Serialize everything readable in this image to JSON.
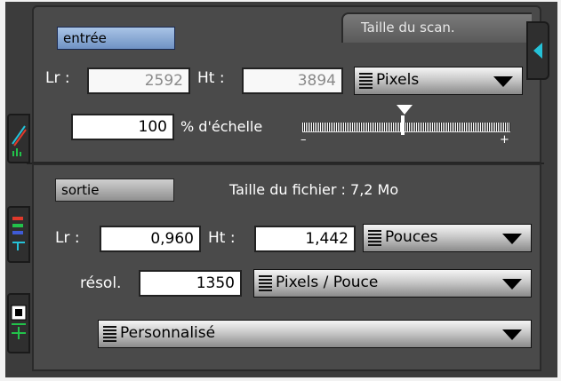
{
  "input": {
    "tag": "entrée",
    "scan_size_title": "Taille du scan.",
    "width_label": "Lr :",
    "width_value": "2592",
    "height_label": "Ht :",
    "height_value": "3894",
    "unit": "Pixels",
    "scale_value": "100",
    "scale_label": "% d'échelle",
    "slider_minus": "–",
    "slider_plus": "+"
  },
  "output": {
    "tag": "sortie",
    "file_size": "Taille du fichier : 7,2 Mo",
    "width_label": "Lr :",
    "width_value": "0,960",
    "height_label": "Ht :",
    "height_value": "1,442",
    "unit": "Pouces",
    "resolution_label": "résol.",
    "resolution_value": "1350",
    "resolution_unit": "Pixels / Pouce",
    "preset": "Personnalisé"
  },
  "icons": {
    "side_tab_1": "color-curve-icon",
    "side_tab_2": "levels-icon",
    "side_tab_3": "frame-add-icon",
    "right_tab": "collapse-arrow-icon"
  },
  "colors": {
    "panel_bg": "#4a4a4a",
    "input_tag": "#8fabd8",
    "accent_cyan": "#25c2d8",
    "accent_green": "#22c24a",
    "accent_red": "#e0392b",
    "accent_blue": "#3f5bd6"
  }
}
